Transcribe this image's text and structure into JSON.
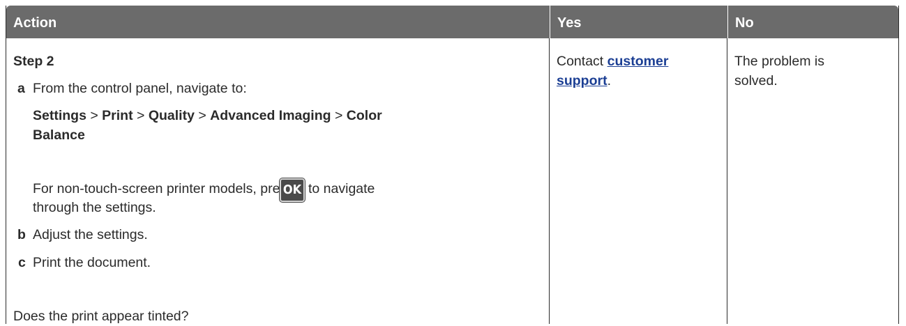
{
  "table": {
    "headers": {
      "action": "Action",
      "yes": "Yes",
      "no": "No"
    },
    "step_title": "Step 2",
    "substeps": [
      {
        "letter": "a",
        "text": "From the control panel, navigate to:"
      },
      {
        "letter": "b",
        "text": "Adjust the settings."
      },
      {
        "letter": "c",
        "text": "Print the document."
      }
    ],
    "path": {
      "settings": "Settings",
      "print": "Print",
      "quality": "Quality",
      "advanced_imaging": "Advanced Imaging",
      "color": "Color",
      "balance": "Balance",
      "separator": ">"
    },
    "non_touch": {
      "prefix": "For non-touch-screen printer models, press",
      "key": "OK",
      "suffix": "to navigate",
      "line2": "through the settings."
    },
    "question": "Does the print appear tinted?",
    "yes_cell": {
      "prefix": "Contact",
      "link_line1": "customer",
      "link_line2": "support",
      "suffix": "."
    },
    "no_cell": {
      "line1": "The problem is",
      "line2": "solved."
    }
  }
}
